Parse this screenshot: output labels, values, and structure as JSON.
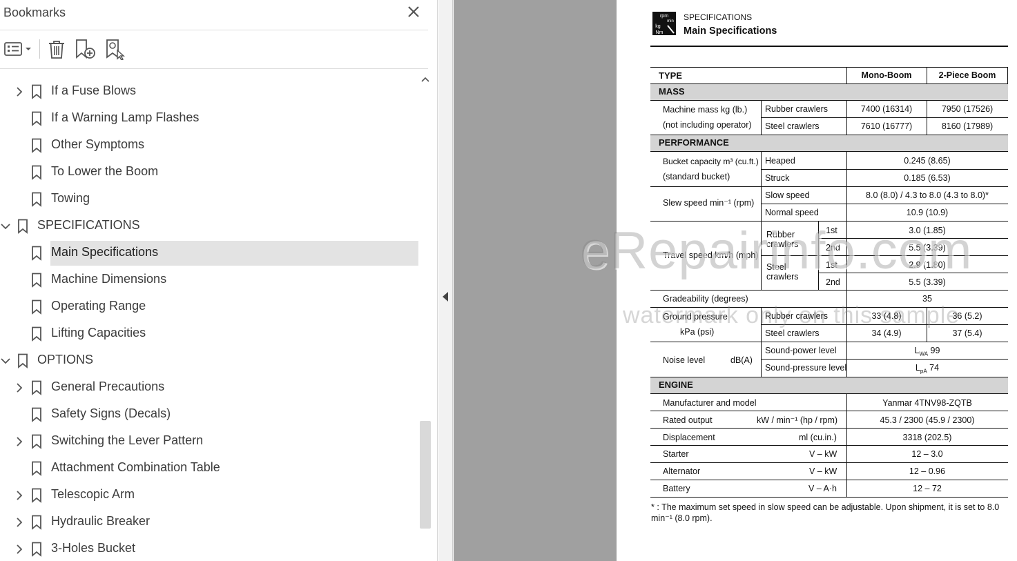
{
  "panel": {
    "title": "Bookmarks",
    "close_glyph": "✕",
    "toolbar": {
      "options_icon": "list-options-icon",
      "delete_icon": "trash-icon",
      "new_icon": "add-bookmark-icon",
      "find_icon": "find-bookmark-icon"
    },
    "items": [
      {
        "label": "If a Fuse Blows",
        "level": 1,
        "expander": "collapsed"
      },
      {
        "label": "If a Warning Lamp Flashes",
        "level": 1,
        "expander": "none"
      },
      {
        "label": "Other Symptoms",
        "level": 1,
        "expander": "none"
      },
      {
        "label": "To Lower the Boom",
        "level": 1,
        "expander": "none"
      },
      {
        "label": "Towing",
        "level": 1,
        "expander": "none"
      },
      {
        "label": "SPECIFICATIONS",
        "level": 0,
        "expander": "expanded"
      },
      {
        "label": "Main Specifications",
        "level": 1,
        "expander": "none",
        "selected": true
      },
      {
        "label": "Machine Dimensions",
        "level": 1,
        "expander": "none"
      },
      {
        "label": "Operating Range",
        "level": 1,
        "expander": "none"
      },
      {
        "label": "Lifting Capacities",
        "level": 1,
        "expander": "none"
      },
      {
        "label": "OPTIONS",
        "level": 0,
        "expander": "expanded"
      },
      {
        "label": "General Precautions",
        "level": 1,
        "expander": "collapsed"
      },
      {
        "label": "Safety Signs (Decals)",
        "level": 1,
        "expander": "none"
      },
      {
        "label": "Switching the Lever Pattern",
        "level": 1,
        "expander": "collapsed"
      },
      {
        "label": "Attachment Combination Table",
        "level": 1,
        "expander": "none"
      },
      {
        "label": "Telescopic Arm",
        "level": 1,
        "expander": "collapsed"
      },
      {
        "label": "Hydraulic Breaker",
        "level": 1,
        "expander": "collapsed"
      },
      {
        "label": "3-Holes Bucket",
        "level": 1,
        "expander": "collapsed"
      }
    ]
  },
  "page": {
    "logo_text": [
      "rpm",
      "min",
      "kg",
      "Nm"
    ],
    "section": "SPECIFICATIONS",
    "heading": "Main Specifications",
    "table": {
      "type_label": "TYPE",
      "col_mono": "Mono-Boom",
      "col_two": "2-Piece Boom",
      "mass": {
        "section": "MASS",
        "label1": "Machine mass  kg (lb.)",
        "label2": "(not including operator)",
        "rubber": "Rubber crawlers",
        "steel": "Steel crawlers",
        "rubber_mono": "7400 (16314)",
        "rubber_two": "7950 (17526)",
        "steel_mono": "7610 (16777)",
        "steel_two": "8160 (17989)"
      },
      "performance": {
        "section": "PERFORMANCE",
        "bucket_label1": "Bucket capacity m³ (cu.ft.)",
        "bucket_label2": "(standard bucket)",
        "heaped": "Heaped",
        "heaped_value": "0.245 (8.65)",
        "struck": "Struck",
        "struck_value": "0.185 (6.53)",
        "slew_label": "Slew speed  min⁻¹ (rpm)",
        "slow": "Slow speed",
        "slow_value": "8.0 (8.0) / 4.3 to 8.0 (4.3 to 8.0)*",
        "normal": "Normal speed",
        "normal_value": "10.9 (10.9)",
        "travel_label": "Travel speed km/h (mph)",
        "rubber1": "Rubber",
        "rubber2": "crawlers",
        "steel1": "Steel",
        "steel2": "crawlers",
        "first": "1st",
        "second": "2nd",
        "rubber_1st": "3.0 (1.85)",
        "rubber_2nd": "5.5 (3.39)",
        "steel_1st": "2.9 (1.80)",
        "steel_2nd": "5.5 (3.39)",
        "grade_label": "Gradeability (degrees)",
        "grade_value": "35",
        "ground_label1": "Ground pressure",
        "ground_label2": "kPa (psi)",
        "ground_rubber": "Rubber crawlers",
        "ground_steel": "Steel crawlers",
        "ground_rubber_mono": "33 (4.8)",
        "ground_rubber_two": "36 (5.2)",
        "ground_steel_mono": "34 (4.9)",
        "ground_steel_two": "37 (5.4)",
        "noise_label": "Noise level",
        "noise_unit": "dB(A)",
        "power_level": "Sound-power level",
        "power_sym": "L",
        "power_sub": "WA",
        "power_value": " 99",
        "pressure_level": "Sound-pressure level",
        "pressure_sym": "L",
        "pressure_sub": "pA",
        "pressure_value": " 74"
      },
      "engine": {
        "section": "ENGINE",
        "rows": [
          {
            "label": "Manufacturer and model",
            "unit": "",
            "value": "Yanmar 4TNV98-ZQTB"
          },
          {
            "label": "Rated output",
            "unit": "kW / min⁻¹ (hp / rpm)",
            "value": "45.3 / 2300 (45.9 / 2300)"
          },
          {
            "label": "Displacement",
            "unit": "ml (cu.in.)",
            "value": "3318 (202.5)"
          },
          {
            "label": "Starter",
            "unit": "V – kW",
            "value": "12 – 3.0"
          },
          {
            "label": "Alternator",
            "unit": "V – kW",
            "value": "12 – 0.96"
          },
          {
            "label": "Battery",
            "unit": "V – A·h",
            "value": "12 – 72"
          }
        ]
      }
    },
    "footnote_mark": "*",
    "footnote": ":  The maximum set speed in slow speed can be adjustable. Upon shipment, it is set to 8.0 min⁻¹ (8.0 rpm)."
  },
  "watermark": {
    "line1": "eRepairinfo.com",
    "line2": "watermark only on this sample"
  }
}
